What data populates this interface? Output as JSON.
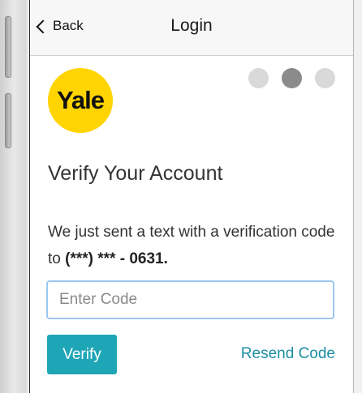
{
  "navbar": {
    "back_label": "Back",
    "title": "Login"
  },
  "logo": {
    "text": "Yale",
    "color": "#ffd400"
  },
  "progress": {
    "steps": 3,
    "current_step": 2
  },
  "main": {
    "heading": "Verify Your Account",
    "message_prefix": "We just sent a text with a verification code to",
    "masked_phone": "(***) *** - 0631."
  },
  "code_field": {
    "placeholder": "Enter Code",
    "value": ""
  },
  "actions": {
    "verify_label": "Verify",
    "resend_label": "Resend Code"
  },
  "colors": {
    "accent": "#1ea6b7",
    "link": "#1b8fa4",
    "input_border": "#9cc7ee"
  }
}
